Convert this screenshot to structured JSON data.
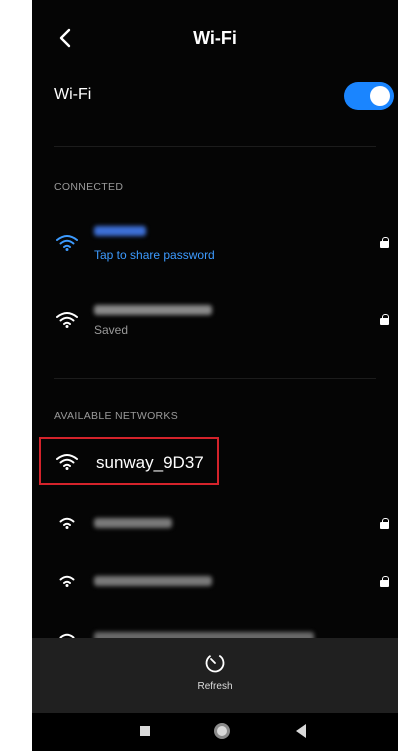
{
  "header": {
    "title": "Wi-Fi",
    "back_icon": "chevron-left-icon"
  },
  "wifi_toggle": {
    "label": "Wi-Fi",
    "state": "on",
    "accent": "#1a85ff"
  },
  "connected_section": {
    "heading": "CONNECTED",
    "networks": [
      {
        "status": "Tap to share password",
        "status_color": "#3d9bff",
        "secured": true
      },
      {
        "status": "Saved",
        "status_color": "#9a9a9a",
        "secured": true
      }
    ]
  },
  "available_section": {
    "heading": "AVAILABLE NETWORKS",
    "networks": [
      {
        "name": "sunway_9D37",
        "secured": false,
        "highlighted": true
      },
      {
        "secured": true
      },
      {
        "secured": true
      },
      {
        "secured": true
      }
    ]
  },
  "bottom_bar": {
    "refresh_label": "Refresh"
  },
  "highlight_color": "#d4232b"
}
